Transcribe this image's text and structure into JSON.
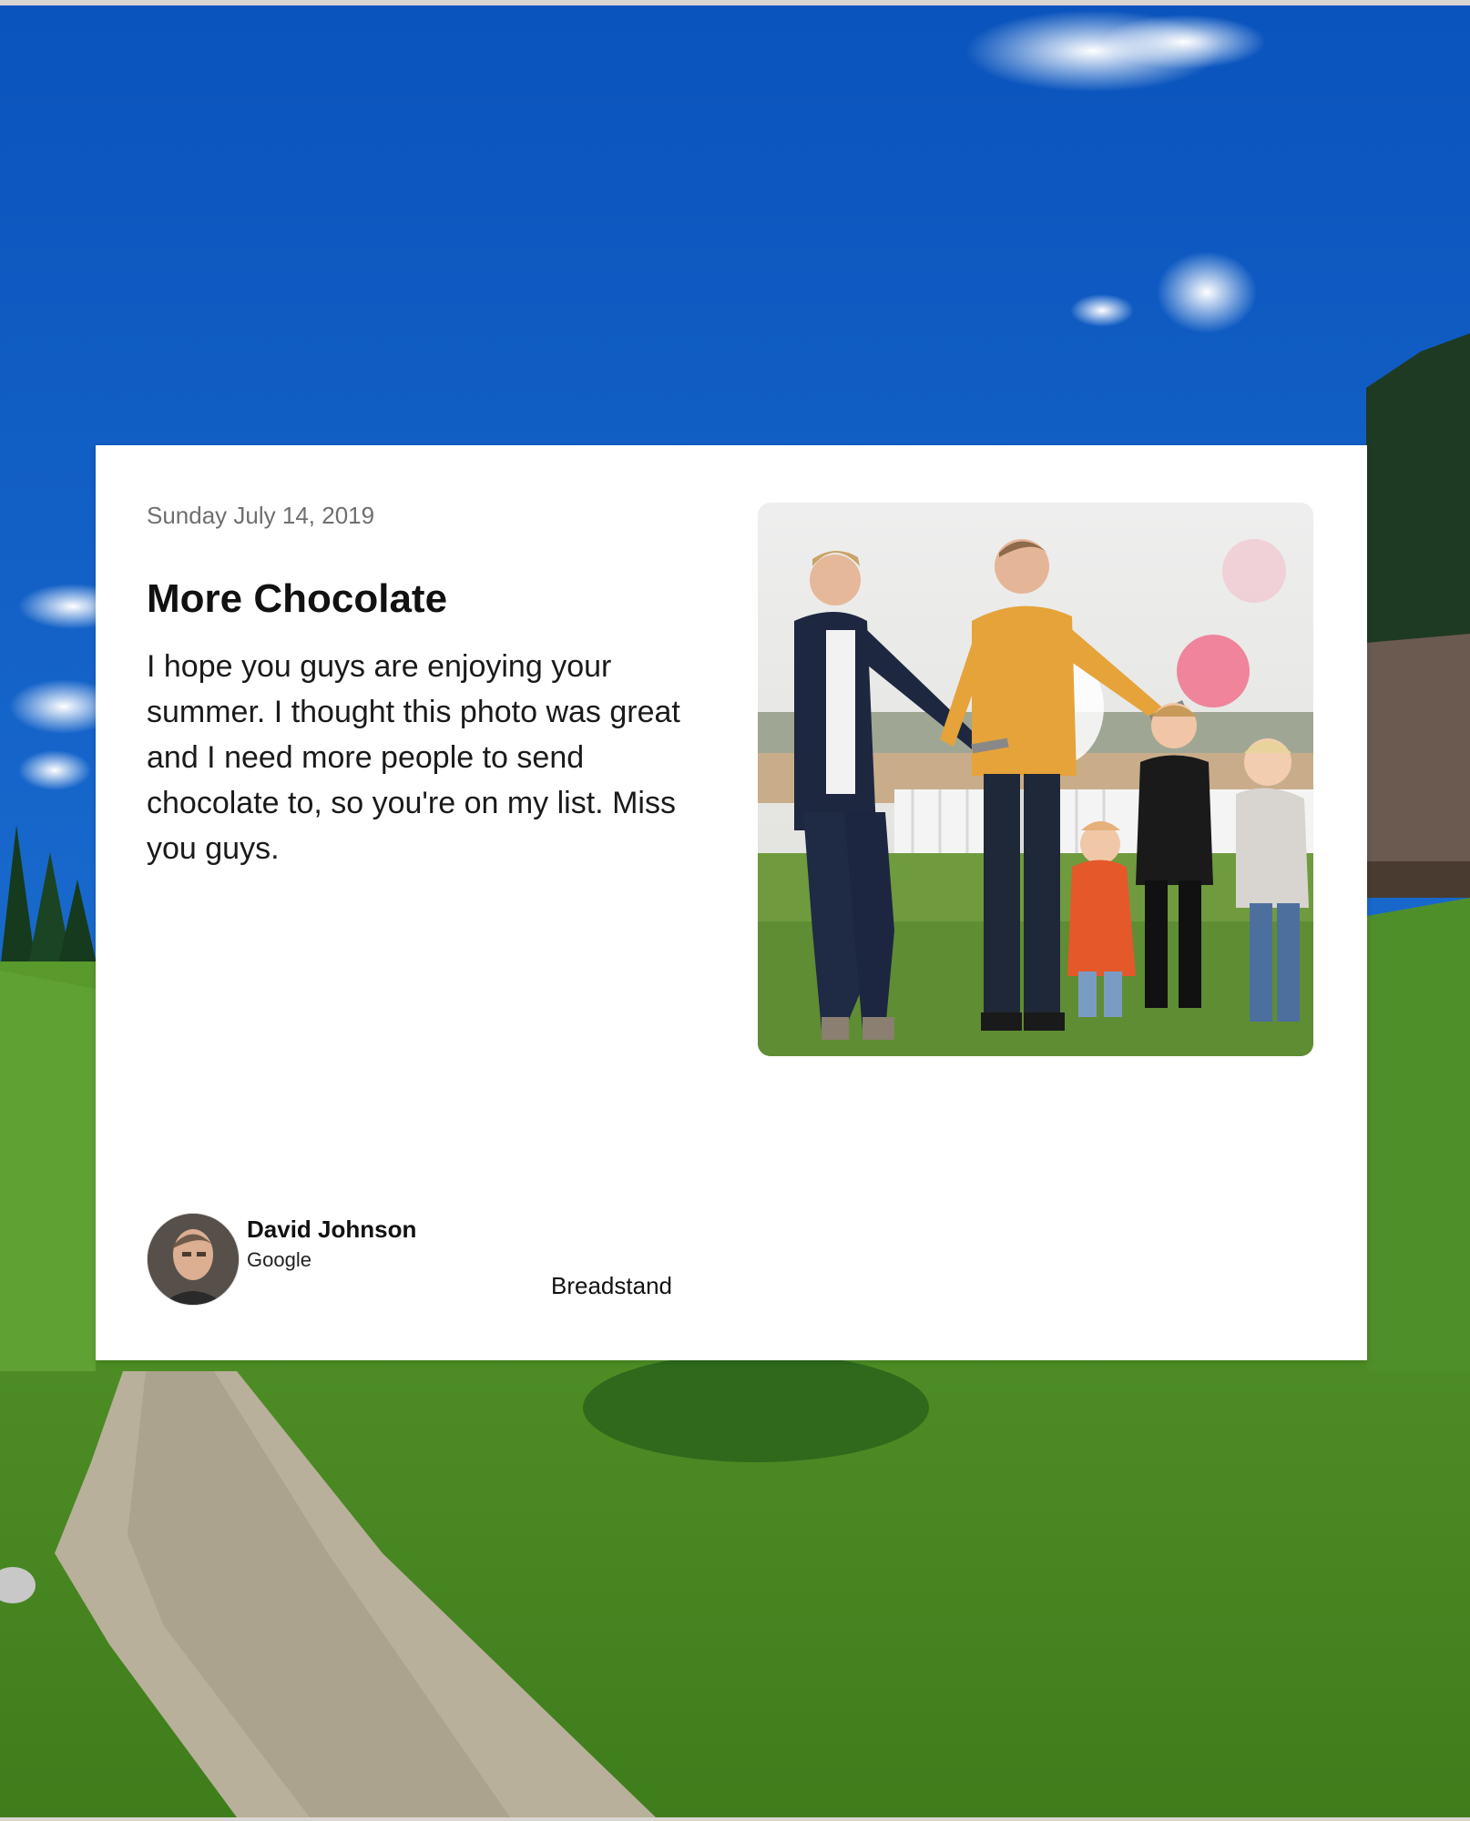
{
  "post": {
    "date": "Sunday July 14, 2019",
    "title": "More Chocolate",
    "message": "I hope you guys are enjoying your summer. I thought this photo was great and I need more people to send chocolate to, so you're on my list. Miss you guys."
  },
  "author": {
    "name": "David Johnson",
    "company": "Google"
  },
  "brand": {
    "label": "Breadstand"
  },
  "icons": {
    "photo": "family-photo",
    "avatar": "author-avatar",
    "background": "landscape-background"
  }
}
